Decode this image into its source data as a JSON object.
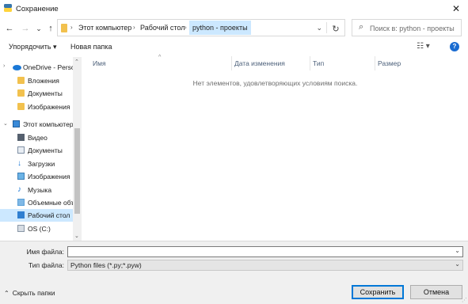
{
  "window": {
    "title": "Сохранение",
    "close_glyph": "✕"
  },
  "nav": {
    "back_glyph": "←",
    "forward_glyph": "→",
    "recent_glyph": "⌄",
    "up_glyph": "↑",
    "breadcrumbs": [
      "Этот компьютер",
      "Рабочий стол",
      "python - проекты"
    ],
    "separator_glyph": "›",
    "dropdown_glyph": "⌄",
    "refresh_glyph": "↻",
    "search_glyph": "⌕",
    "search_placeholder": "Поиск в: python - проекты"
  },
  "toolbar": {
    "organize_label": "Упорядочить ▾",
    "new_folder_label": "Новая папка",
    "view_glyph": "☷ ▾",
    "help_glyph": "?"
  },
  "sidebar": {
    "items": [
      {
        "label": "OneDrive - Person",
        "icon": "onedrive-cloud-icon"
      },
      {
        "label": "Вложения",
        "icon": "folder-icon"
      },
      {
        "label": "Документы",
        "icon": "folder-icon"
      },
      {
        "label": "Изображения",
        "icon": "folder-icon"
      },
      {
        "label": "Этот компьютер",
        "icon": "computer-icon"
      },
      {
        "label": "Видео",
        "icon": "video-icon"
      },
      {
        "label": "Документы",
        "icon": "documents-icon"
      },
      {
        "label": "Загрузки",
        "icon": "downloads-icon"
      },
      {
        "label": "Изображения",
        "icon": "pictures-icon"
      },
      {
        "label": "Музыка",
        "icon": "music-icon"
      },
      {
        "label": "Объемные объекты",
        "icon": "3d-objects-icon"
      },
      {
        "label": "Рабочий стол",
        "icon": "desktop-icon"
      },
      {
        "label": "OS (C:)",
        "icon": "drive-icon"
      }
    ],
    "selected": "Рабочий стол",
    "scroll_up_glyph": "⌃",
    "scroll_down_glyph": "⌄"
  },
  "filelist": {
    "columns": [
      "Имя",
      "Дата изменения",
      "Тип",
      "Размер"
    ],
    "sort_glyph": "^",
    "empty_message": "Нет элементов, удовлетворяющих условиям поиска."
  },
  "bottom": {
    "filename_label": "Имя файла:",
    "filename_value": "",
    "filetype_label": "Тип файла:",
    "filetype_value": "Python files (*.py;*.pyw)",
    "dropdown_glyph": "⌄",
    "hide_folders_label": "Скрыть папки",
    "hide_folders_glyph": "⌃",
    "save_label": "Сохранить",
    "cancel_label": "Отмена"
  },
  "colors": {
    "selection": "#cce8ff",
    "accent": "#0078d7",
    "folder": "#f2c14e"
  }
}
